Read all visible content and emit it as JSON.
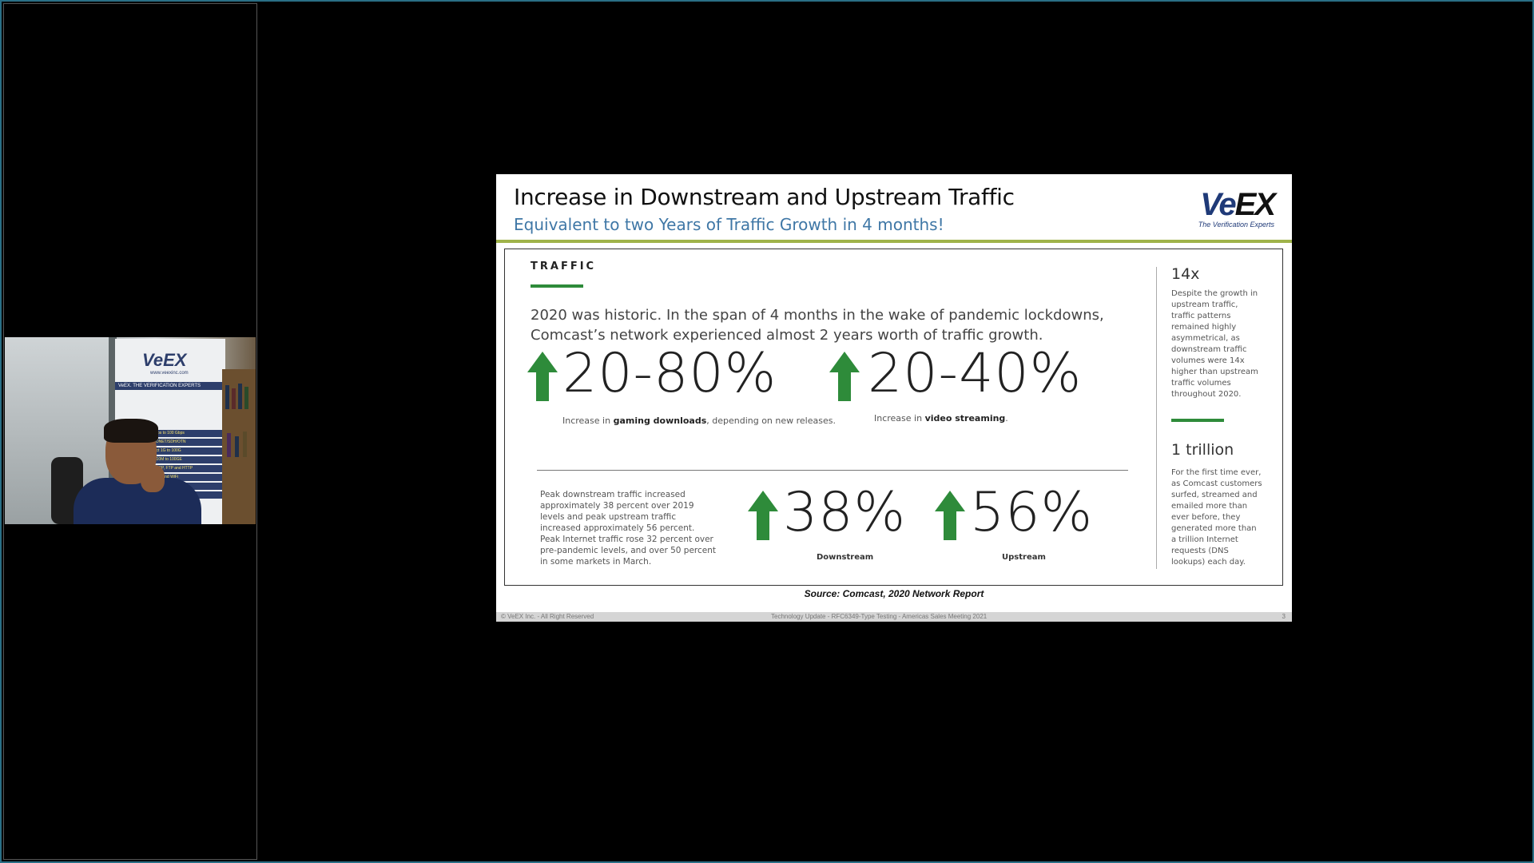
{
  "webcam": {
    "banner_logo": "VeEX",
    "banner_site": "www.veexinc.com",
    "banner_tag": "VeEX. THE VERIFICATION EXPERTS",
    "banner_items": [
      "Mbps to 100 Gbps",
      "/SONET/SDH/OTN",
      "nect 1G to 100G",
      "et 10M to 100GE",
      "P, TCP, FTP and HTTP",
      "ISDN and WiFi",
      "Ascend",
      "Analysis"
    ]
  },
  "slide": {
    "title": "Increase in Downstream and Upstream Traffic",
    "subtitle": "Equivalent to two Years of Traffic Growth in 4 months!",
    "logo_main": "Ve",
    "logo_x": "EX",
    "logo_tagline": "The Verification Experts",
    "section_label": "TRAFFIC",
    "intro": "2020 was historic. In the span of 4 months in the wake of pandemic lockdowns, Comcast’s network experienced almost 2 years worth of traffic growth.",
    "stat1": {
      "value": "20-80%",
      "caption_pre": "Increase in ",
      "caption_bold": "gaming downloads",
      "caption_post": ", depending on new releases."
    },
    "stat2": {
      "value": "20-40%",
      "caption_pre": "Increase in ",
      "caption_bold": "video streaming",
      "caption_post": "."
    },
    "peak_text": "Peak downstream traffic increased approximately 38 percent over 2019 levels and peak upstream traffic increased approximately 56 percent. Peak Internet traffic rose 32 percent over pre-pandemic levels, and over 50 percent in some markets in March.",
    "stat3": {
      "value": "38%",
      "caption": "Downstream"
    },
    "stat4": {
      "value": "56%",
      "caption": "Upstream"
    },
    "side1": {
      "head": "14x",
      "text": "Despite the growth in upstream traffic, traffic patterns remained highly asymmetrical, as downstream traffic volumes were 14x higher than upstream traffic volumes throughout 2020."
    },
    "side2": {
      "head": "1 trillion",
      "text": "For the first time ever, as Comcast customers surfed, streamed and emailed more than ever before, they generated more than a trillion Internet requests (DNS lookups) each day."
    },
    "source": "Source: Comcast, 2020 Network Report",
    "footer": {
      "left": "© VeEX Inc. - All Right Reserved",
      "center": "Technology Update - RFC6349-Type Testing - Americas Sales Meeting 2021",
      "right": "3"
    }
  },
  "colors": {
    "accent_green": "#2e8b3a",
    "header_rule": "#9fb34a",
    "subtitle_blue": "#3f77a6",
    "brand_navy": "#1f3a78"
  }
}
